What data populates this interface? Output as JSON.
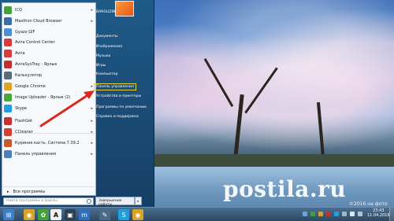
{
  "start_menu": {
    "programs": [
      {
        "label": "ICQ",
        "color": "#3fa33a",
        "arrow": true
      },
      {
        "label": "Maxthon Cloud Browser",
        "color": "#3b6ea5",
        "arrow": true
      },
      {
        "label": "Gyazo GIF",
        "color": "#4a90d9",
        "arrow": false
      },
      {
        "label": "Avira Control Center",
        "color": "#d83b3b",
        "arrow": false
      },
      {
        "label": "Avira",
        "color": "#d83b3b",
        "arrow": false
      },
      {
        "label": "AviraSysTray - Ярлык",
        "color": "#c42f2f",
        "arrow": false
      },
      {
        "label": "Калькулятор",
        "color": "#5b6b7a",
        "arrow": false
      },
      {
        "label": "Google Chrome",
        "color": "#e2a124",
        "arrow": true
      },
      {
        "label": "Image Uploader - Ярлык (2)",
        "color": "#46a83b",
        "arrow": false
      },
      {
        "label": "Skype",
        "color": "#1ea0e0",
        "arrow": true
      },
      {
        "label": "FlashGet",
        "color": "#c9302c",
        "arrow": true
      },
      {
        "label": "CCleaner",
        "color": "#d43f2f",
        "arrow": true
      },
      {
        "label": "Куриная касть. Система 7.39.2",
        "color": "#c85a2a",
        "arrow": true
      },
      {
        "label": "Панель управления",
        "color": "#4f7fb8",
        "arrow": true
      }
    ],
    "all_programs": "Все программы",
    "search_placeholder": "Найти программы и файлы",
    "user_name": "BARGUZIN",
    "right_items": [
      "Документы",
      "Изображения",
      "Музыка",
      "Игры",
      "Компьютер",
      "Панель управления",
      "Устройства и принтеры",
      "Программы по умолчанию",
      "Справка и поддержка"
    ],
    "highlighted_item": "Панель управления",
    "shutdown_label": "Завершение работы",
    "shutdown_arrow": "▸"
  },
  "desktop": {
    "watermark": "postila.ru",
    "watermark_sub": "©2016 на фото"
  },
  "taskbar": {
    "apps": [
      {
        "name": "start-button",
        "glyph": "⊞",
        "color": "#3d7fc8"
      },
      {
        "name": "chrome-app",
        "glyph": "◉",
        "color": "#d9a326"
      },
      {
        "name": "icq-app",
        "glyph": "✿",
        "color": "#3fa33a"
      },
      {
        "name": "font-app",
        "glyph": "A",
        "color": "#f0f0f0"
      },
      {
        "name": "unknown-app",
        "glyph": "▣",
        "color": "#2b3f55"
      },
      {
        "name": "maxthon-app",
        "glyph": "m",
        "color": "#2f6fc0"
      },
      {
        "name": "tool-app",
        "glyph": "✎",
        "color": "#4d6a85"
      },
      {
        "name": "skype-app",
        "glyph": "S",
        "color": "#1ea0e0"
      },
      {
        "name": "chrome-app-2",
        "glyph": "◉",
        "color": "#d9a326"
      }
    ],
    "time": "23:43",
    "date": "11.04.2016"
  }
}
